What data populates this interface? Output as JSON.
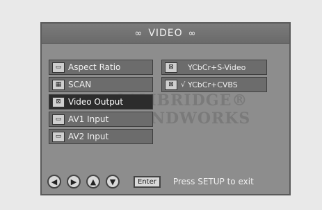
{
  "header": {
    "title": "VIDEO",
    "deco_left": "∞",
    "deco_right": "∞"
  },
  "watermark": {
    "line1": "CAMBRIDGE®",
    "line2": "SOUNDWORKS"
  },
  "menu": {
    "items": [
      {
        "label": "Aspect Ratio",
        "icon": "screen-icon"
      },
      {
        "label": "SCAN",
        "icon": "scan-icon"
      },
      {
        "label": "Video Output",
        "icon": "video-output-icon",
        "selected": true
      },
      {
        "label": "AV1 Input",
        "icon": "tv-icon"
      },
      {
        "label": "AV2 Input",
        "icon": "tv-icon"
      }
    ]
  },
  "options": {
    "items": [
      {
        "label": "YCbCr+S-Video",
        "checked": false,
        "icon": "video-output-icon"
      },
      {
        "label": "YCbCr+CVBS",
        "checked": true,
        "icon": "video-output-icon"
      }
    ]
  },
  "footer": {
    "enter_label": "Enter",
    "hint": "Press SETUP to exit",
    "nav_icons": [
      "left-arrow-icon",
      "right-arrow-icon",
      "up-arrow-icon",
      "down-arrow-icon"
    ]
  }
}
